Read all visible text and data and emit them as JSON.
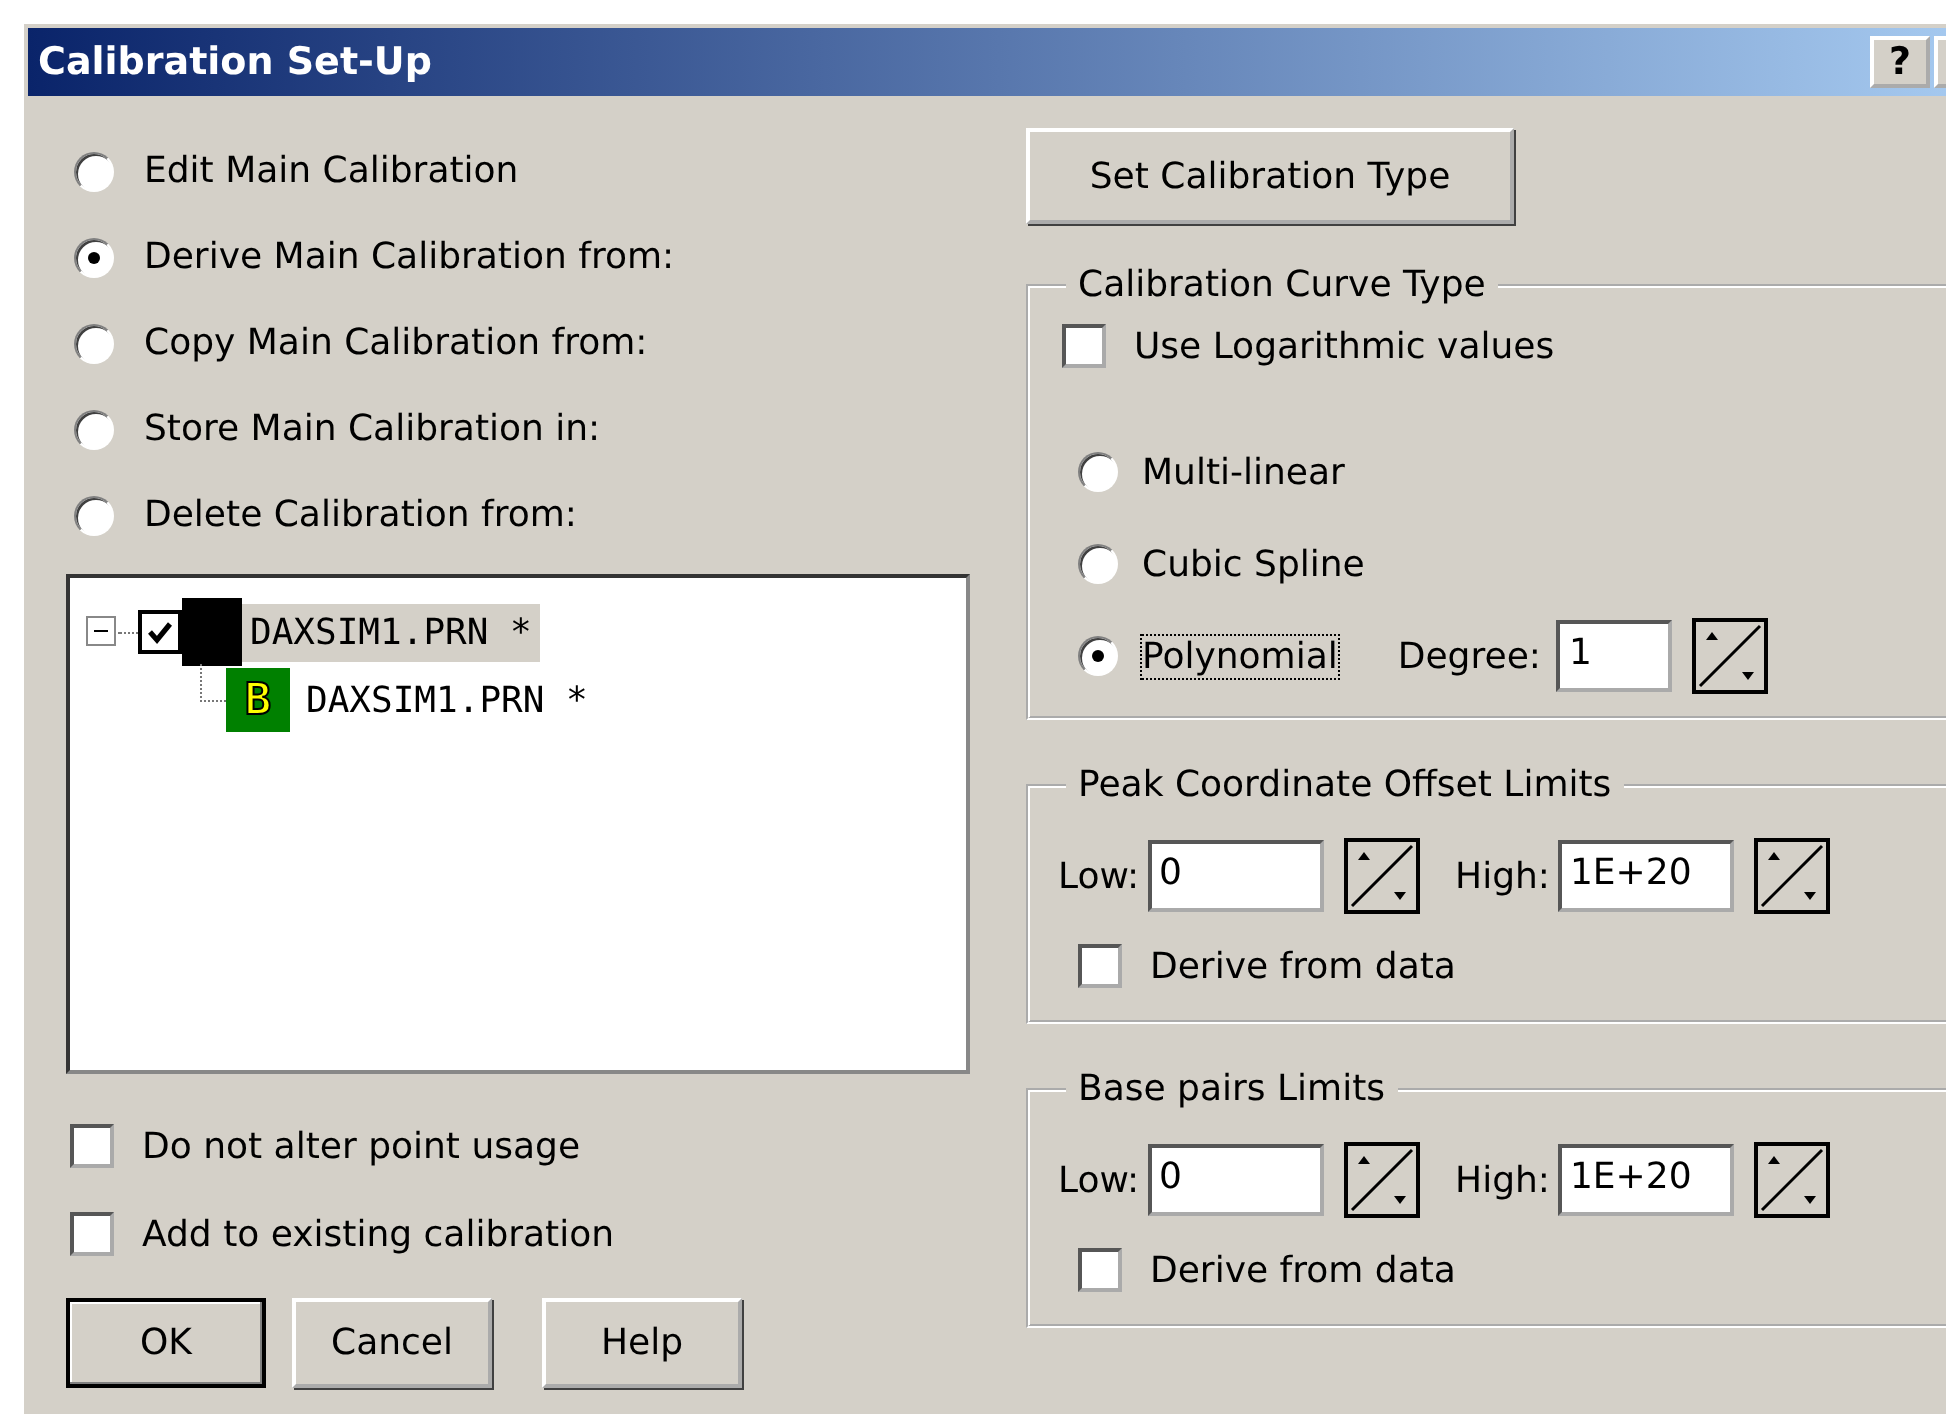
{
  "window": {
    "title": "Calibration Set-Up",
    "help_button": "?"
  },
  "modes": [
    {
      "label": "Edit Main Calibration",
      "selected": false
    },
    {
      "label": "Derive Main Calibration from:",
      "selected": true
    },
    {
      "label": "Copy Main Calibration from:",
      "selected": false
    },
    {
      "label": "Store Main Calibration in:",
      "selected": false
    },
    {
      "label": "Delete Calibration from:",
      "selected": false
    }
  ],
  "tree": [
    {
      "label": "DAXSIM1.PRN *",
      "checked": true,
      "expanded": true,
      "selected": true,
      "children": [
        {
          "badge": "B",
          "label": "DAXSIM1.PRN *",
          "selected": false
        }
      ]
    }
  ],
  "options": [
    {
      "label": "Do not alter point usage",
      "checked": false
    },
    {
      "label": "Add to existing calibration",
      "checked": false
    }
  ],
  "buttons": [
    {
      "label": "OK",
      "default": true
    },
    {
      "label": "Cancel",
      "default": false
    },
    {
      "label": "Help",
      "default": false
    }
  ],
  "set_type_button": "Set Calibration Type",
  "curve_group": {
    "title": "Calibration Curve Type",
    "log_option": {
      "label": "Use Logarithmic values",
      "checked": false
    },
    "curves": [
      {
        "label": "Multi-linear",
        "selected": false,
        "focused": false
      },
      {
        "label": "Cubic Spline",
        "selected": false,
        "focused": false
      },
      {
        "label": "Polynomial",
        "selected": true,
        "focused": true
      }
    ],
    "degree": {
      "label": "Degree:",
      "value": "1"
    }
  },
  "limit_groups": [
    {
      "title": "Peak Coordinate Offset Limits",
      "low": {
        "label": "Low:",
        "value": "0"
      },
      "high": {
        "label": "High:",
        "value": "1E+20"
      },
      "derive": {
        "label": "Derive from data",
        "checked": false
      }
    },
    {
      "title": "Base pairs Limits",
      "low": {
        "label": "Low:",
        "value": "0"
      },
      "high": {
        "label": "High:",
        "value": "1E+20"
      },
      "derive": {
        "label": "Derive from data",
        "checked": false
      }
    }
  ]
}
